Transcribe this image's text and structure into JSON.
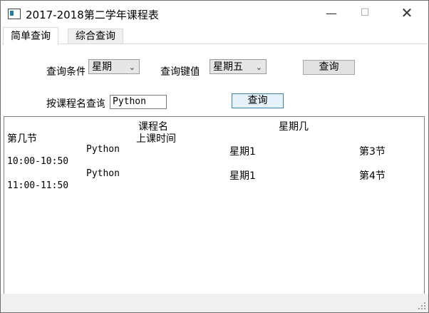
{
  "window": {
    "title": "2017-2018第二学年课程表",
    "controls": {
      "minimize": "—",
      "maximize": "☐",
      "close": "✕"
    }
  },
  "tabs": [
    {
      "label": "简单查询",
      "active": true
    },
    {
      "label": "综合查询",
      "active": false
    }
  ],
  "query": {
    "condition_label": "查询条件",
    "condition_value": "星期",
    "keyword_label": "查询键值",
    "keyword_value": "星期五",
    "query_button": "查询",
    "course_label": "按课程名查询",
    "course_value": "Python",
    "course_query_button": "查询"
  },
  "results": {
    "headers": {
      "course_name": "课程名",
      "weekday": "星期几",
      "period": "第几节",
      "time": "上课时间"
    },
    "rows": [
      {
        "course": "Python",
        "weekday": "星期1",
        "period": "第3节",
        "time": "10:00-10:50"
      },
      {
        "course": "Python",
        "weekday": "星期1",
        "period": "第4节",
        "time": "11:00-11:50"
      }
    ]
  },
  "colors": {
    "accent_border": "#3c7fb1",
    "button_face": "#e1e1e1",
    "status_bar": "#f0f0f0"
  }
}
